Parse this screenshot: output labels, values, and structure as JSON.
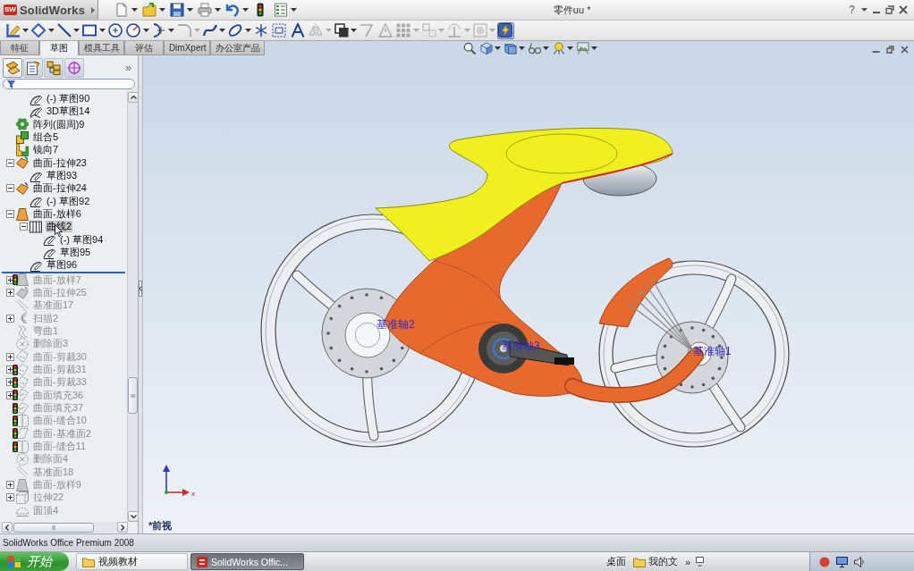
{
  "window": {
    "title": "零件uu *",
    "help": "?"
  },
  "app_menu": {
    "badge": "SW",
    "label": "SolidWorks"
  },
  "standard_toolbar": [
    {
      "dropdown": true
    },
    {
      "dropdown": true
    },
    {
      "dropdown": true
    },
    {
      "dropdown": true
    },
    {
      "dropdown": true
    },
    {
      "dropdown": false
    },
    {
      "dropdown": true
    }
  ],
  "sketch_toolbar": [
    {
      "dropdown": true,
      "disabled": false,
      "on": false
    },
    {
      "dropdown": true,
      "disabled": false,
      "on": false
    },
    {
      "dropdown": true,
      "disabled": false,
      "on": false
    },
    {
      "dropdown": true,
      "disabled": false,
      "on": false
    },
    {
      "dropdown": false,
      "disabled": false,
      "on": false
    },
    {
      "dropdown": true,
      "disabled": false,
      "on": false
    },
    {
      "dropdown": true,
      "disabled": false,
      "on": false
    },
    {
      "dropdown": true,
      "disabled": true,
      "on": false
    },
    {
      "dropdown": true,
      "disabled": false,
      "on": false
    },
    {
      "dropdown": true,
      "disabled": false,
      "on": false
    },
    {
      "dropdown": false,
      "disabled": false,
      "on": false
    },
    {
      "dropdown": false,
      "disabled": false,
      "on": false
    },
    {
      "dropdown": false,
      "disabled": false,
      "on": false
    },
    {
      "dropdown": true,
      "disabled": true,
      "on": false
    },
    {
      "dropdown": true,
      "disabled": false,
      "on": false
    },
    {
      "dropdown": false,
      "disabled": true,
      "on": false
    },
    {
      "dropdown": false,
      "disabled": true,
      "on": false
    },
    {
      "dropdown": true,
      "disabled": true,
      "on": false
    },
    {
      "dropdown": true,
      "disabled": true,
      "on": false
    },
    {
      "dropdown": true,
      "disabled": true,
      "on": false
    },
    {
      "dropdown": true,
      "disabled": true,
      "on": false
    },
    {
      "dropdown": false,
      "disabled": false,
      "on": true
    }
  ],
  "command_tabs": [
    {
      "label": "特征",
      "selected": false
    },
    {
      "label": "草图",
      "selected": true
    },
    {
      "label": "模具工具",
      "selected": false
    },
    {
      "label": "评估",
      "selected": false
    },
    {
      "label": "DimXpert",
      "selected": false
    },
    {
      "label": "办公室产品",
      "selected": false
    }
  ],
  "view_toolbar": [
    {
      "dropdown": false
    },
    {
      "dropdown": true
    },
    {
      "dropdown": true
    },
    {
      "dropdown": true
    },
    {
      "dropdown": true
    },
    {
      "dropdown": true
    }
  ],
  "panel": {
    "tabs": [
      {
        "selected": true
      },
      {
        "selected": false
      },
      {
        "selected": false
      },
      {
        "selected": false
      }
    ],
    "more": "»"
  },
  "tree": {
    "continued": [
      {
        "kind": "sketch",
        "label": "(-) 草图90",
        "rolled_back": false,
        "warning": false,
        "selected": false
      },
      {
        "kind": "sketch3d",
        "label": "3D草图14",
        "rolled_back": false,
        "warning": false,
        "selected": false
      }
    ],
    "items": [
      {
        "kind": "pattern",
        "label": "阵列(圆周)9",
        "rolled_back": false,
        "warning": false,
        "selected": false
      },
      {
        "kind": "combine",
        "label": "组合5",
        "rolled_back": false,
        "warning": false,
        "selected": false
      },
      {
        "kind": "mirror",
        "label": "镜向7",
        "rolled_back": false,
        "warning": false,
        "selected": false
      },
      {
        "kind": "surface-extrude",
        "label": "曲面-拉伸23",
        "rolled_back": false,
        "warning": false,
        "selected": false,
        "expanded": true,
        "children": [
          {
            "kind": "sketch",
            "label": "草图93",
            "rolled_back": false,
            "warning": false,
            "selected": false
          }
        ]
      },
      {
        "kind": "surface-extrude",
        "label": "曲面-拉伸24",
        "rolled_back": false,
        "warning": false,
        "selected": false,
        "expanded": true,
        "children": [
          {
            "kind": "sketch",
            "label": "(-) 草图92",
            "rolled_back": false,
            "warning": false,
            "selected": false
          }
        ]
      },
      {
        "kind": "surface-loft",
        "label": "曲面-放样6",
        "rolled_back": false,
        "warning": false,
        "selected": false,
        "expanded": true,
        "children": [
          {
            "kind": "curve",
            "label": "曲线2",
            "rolled_back": false,
            "warning": false,
            "selected": true,
            "expanded": true,
            "children": [
              {
                "kind": "sketch",
                "label": "(-) 草图94",
                "rolled_back": false,
                "warning": false,
                "selected": false
              },
              {
                "kind": "sketch",
                "label": "草图95",
                "rolled_back": false,
                "warning": false,
                "selected": false
              }
            ]
          },
          {
            "kind": "sketch",
            "label": "草图96",
            "rolled_back": false,
            "warning": false,
            "selected": false
          }
        ]
      },
      {
        "kind": "surface-loft",
        "label": "曲面-放样7",
        "rolled_back": true,
        "warning": true,
        "selected": false,
        "expanded": false
      },
      {
        "kind": "surface-extrude",
        "label": "曲面-拉伸25",
        "rolled_back": true,
        "warning": false,
        "selected": false,
        "expanded": false
      },
      {
        "kind": "plane",
        "label": "基准面17",
        "rolled_back": true,
        "warning": false,
        "selected": false
      },
      {
        "kind": "sweep",
        "label": "扫描2",
        "rolled_back": true,
        "warning": false,
        "selected": false,
        "expanded": false
      },
      {
        "kind": "flex",
        "label": "弯曲1",
        "rolled_back": true,
        "warning": false,
        "selected": false
      },
      {
        "kind": "delete-face",
        "label": "删除面3",
        "rolled_back": true,
        "warning": false,
        "selected": false
      },
      {
        "kind": "surface-trim",
        "label": "曲面-剪裁30",
        "rolled_back": true,
        "warning": false,
        "selected": false,
        "expanded": false
      },
      {
        "kind": "surface-trim",
        "label": "曲面-剪裁31",
        "rolled_back": true,
        "warning": true,
        "selected": false,
        "expanded": false
      },
      {
        "kind": "surface-trim",
        "label": "曲面-剪裁33",
        "rolled_back": true,
        "warning": true,
        "selected": false,
        "expanded": false
      },
      {
        "kind": "surface-fill",
        "label": "曲面填充36",
        "rolled_back": true,
        "warning": true,
        "selected": false,
        "expanded": false
      },
      {
        "kind": "surface-fill",
        "label": "曲面填充37",
        "rolled_back": true,
        "warning": true,
        "selected": false
      },
      {
        "kind": "surface-knit",
        "label": "曲面-缝合10",
        "rolled_back": true,
        "warning": true,
        "selected": false
      },
      {
        "kind": "surface-plane",
        "label": "曲面-基准面2",
        "rolled_back": true,
        "warning": true,
        "selected": false
      },
      {
        "kind": "surface-knit",
        "label": "曲面-缝合11",
        "rolled_back": true,
        "warning": true,
        "selected": false
      },
      {
        "kind": "delete-face",
        "label": "删除面4",
        "rolled_back": true,
        "warning": false,
        "selected": false
      },
      {
        "kind": "plane",
        "label": "基准面18",
        "rolled_back": true,
        "warning": false,
        "selected": false
      },
      {
        "kind": "surface-loft",
        "label": "曲面-放样9",
        "rolled_back": true,
        "warning": false,
        "selected": false,
        "expanded": false
      },
      {
        "kind": "extrude",
        "label": "拉伸22",
        "rolled_back": true,
        "warning": false,
        "selected": false,
        "expanded": false
      },
      {
        "kind": "dome",
        "label": "圆顶4",
        "rolled_back": true,
        "warning": false,
        "selected": false
      }
    ]
  },
  "graphics": {
    "axis_labels": [
      "基准轴2",
      "基准轴3",
      "基准轴1"
    ],
    "triad_label": "x",
    "view_name": "*前视"
  },
  "status_bar": {
    "text": "SolidWorks Office Premium 2008"
  },
  "taskbar": {
    "start": "开始",
    "tasks": [
      {
        "label": "视频教材",
        "selected": false
      },
      {
        "label": "SolidWorks Offic...",
        "selected": true
      }
    ],
    "quick_links": [
      "桌面",
      "我的文"
    ],
    "more": "»"
  }
}
